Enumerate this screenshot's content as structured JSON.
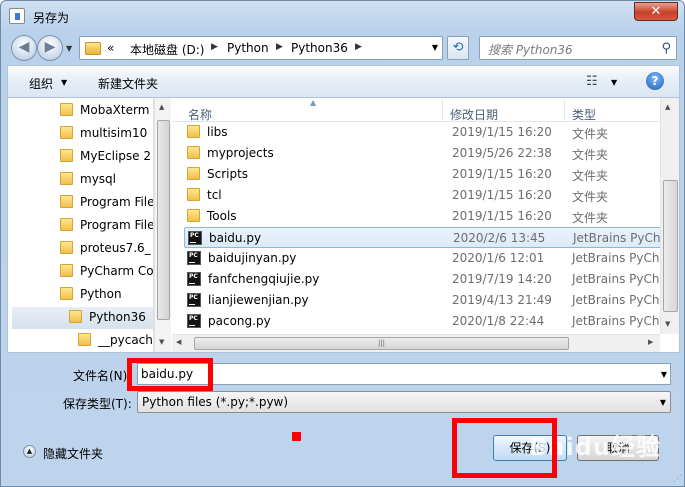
{
  "window": {
    "title": "另存为",
    "close_label": "✕"
  },
  "nav": {
    "back_icon": "◀",
    "forward_icon": "▶",
    "dropdown": "▼",
    "breadcrumb": [
      {
        "label": "«"
      },
      {
        "label": "本地磁盘 (D:)"
      },
      {
        "label": "Python"
      },
      {
        "label": "Python36"
      }
    ],
    "separator": "▶",
    "refresh_icon": "⟲",
    "search_placeholder": "搜索 Python36",
    "search_icon": "⚲"
  },
  "toolbar": {
    "organize": "组织",
    "new_folder": "新建文件夹",
    "view_icon": "☷",
    "help": "?"
  },
  "sidebar": {
    "items": [
      {
        "label": "MobaXterm",
        "indent": 0
      },
      {
        "label": "multisim10",
        "indent": 0
      },
      {
        "label": "MyEclipse 2",
        "indent": 0
      },
      {
        "label": "mysql",
        "indent": 0
      },
      {
        "label": "Program File",
        "indent": 0
      },
      {
        "label": "Program File",
        "indent": 0
      },
      {
        "label": "proteus7.6_",
        "indent": 0
      },
      {
        "label": "PyCharm Co",
        "indent": 0
      },
      {
        "label": "Python",
        "indent": 0
      },
      {
        "label": "Python36",
        "indent": 1,
        "selected": true
      },
      {
        "label": "__pycach",
        "indent": 2
      }
    ]
  },
  "columns": {
    "name": "名称",
    "date": "修改日期",
    "type": "类型"
  },
  "files": [
    {
      "name": "libs",
      "date": "2019/1/15 16:20",
      "type": "文件夹",
      "kind": "folder"
    },
    {
      "name": "myprojects",
      "date": "2019/5/26 22:38",
      "type": "文件夹",
      "kind": "folder"
    },
    {
      "name": "Scripts",
      "date": "2019/1/15 16:20",
      "type": "文件夹",
      "kind": "folder"
    },
    {
      "name": "tcl",
      "date": "2019/1/15 16:20",
      "type": "文件夹",
      "kind": "folder"
    },
    {
      "name": "Tools",
      "date": "2019/1/15 16:20",
      "type": "文件夹",
      "kind": "folder"
    },
    {
      "name": "baidu.py",
      "date": "2020/2/6 13:45",
      "type": "JetBrains PyCha",
      "kind": "py",
      "selected": true
    },
    {
      "name": "baidujinyan.py",
      "date": "2020/1/6 12:01",
      "type": "JetBrains PyCha",
      "kind": "py"
    },
    {
      "name": "fanfchengqiujie.py",
      "date": "2019/7/19 14:20",
      "type": "JetBrains PyCha",
      "kind": "py"
    },
    {
      "name": "lianjiewenjian.py",
      "date": "2019/4/13 21:49",
      "type": "JetBrains PyCha",
      "kind": "py"
    },
    {
      "name": "pacong.py",
      "date": "2020/1/8 22:44",
      "type": "JetBrains PyCha",
      "kind": "py"
    }
  ],
  "form": {
    "filename_label": "文件名(N):",
    "filename_value": "baidu.py",
    "filetype_label": "保存类型(T):",
    "filetype_value": "Python files (*.py;*.pyw)"
  },
  "footer": {
    "hide_folders": "隐藏文件夹",
    "save": "保存(S)",
    "cancel": "取消"
  },
  "watermark": "Baidu经验",
  "colors": {
    "highlight": "#ff0000",
    "selection_border": "#8cb7e4"
  }
}
